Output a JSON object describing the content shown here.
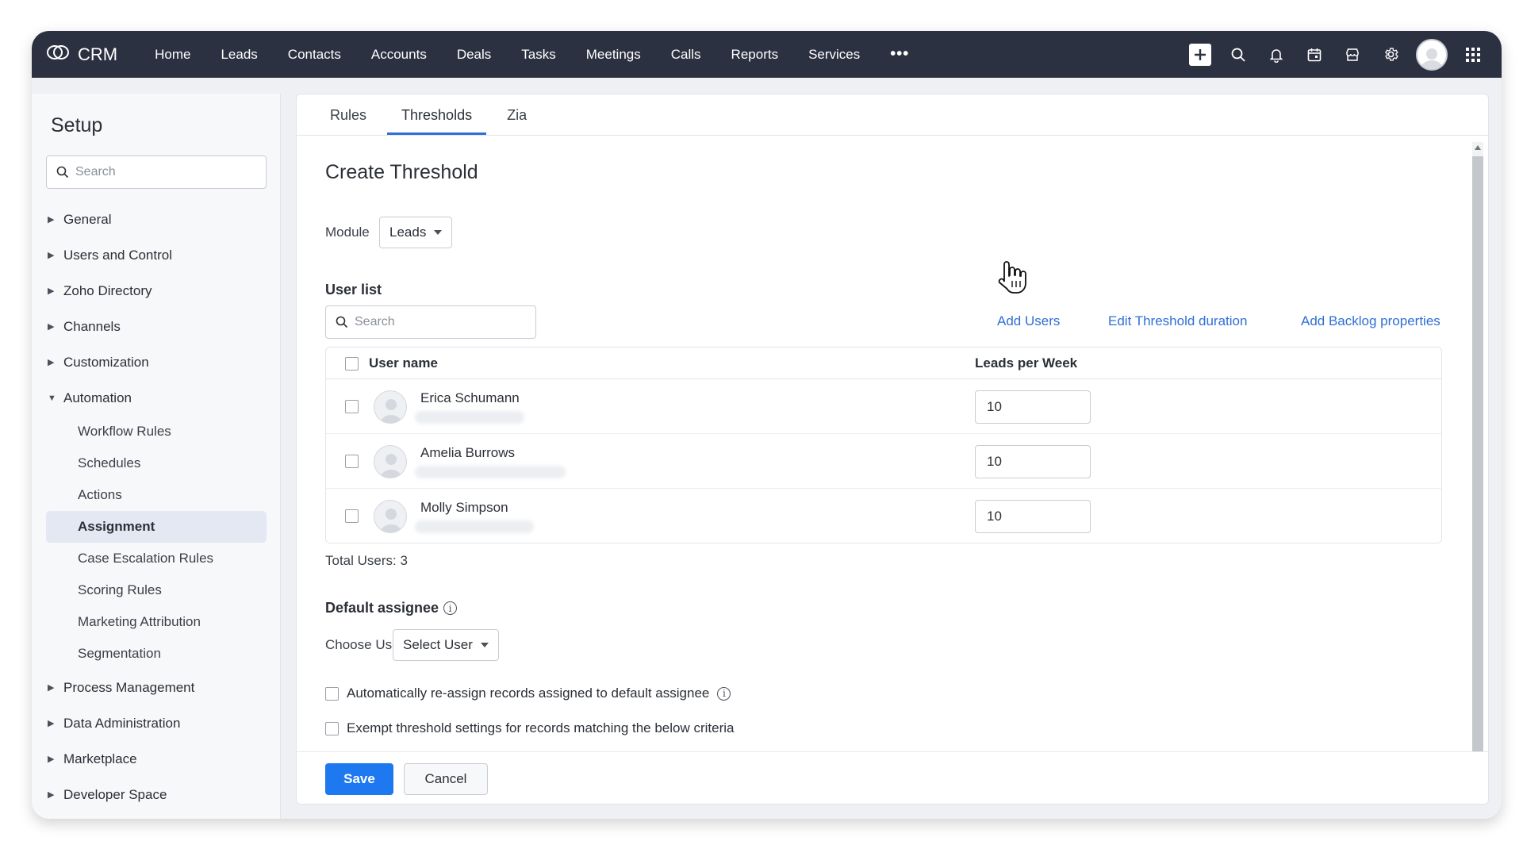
{
  "topbar": {
    "brand": "CRM",
    "nav": [
      "Home",
      "Leads",
      "Contacts",
      "Accounts",
      "Deals",
      "Tasks",
      "Meetings",
      "Calls",
      "Reports",
      "Services"
    ],
    "more": "•••",
    "icons": [
      "plus-icon",
      "search-icon",
      "bell-icon",
      "calendar-icon",
      "marketplace-icon",
      "gear-icon",
      "avatar",
      "apps-grid-icon"
    ]
  },
  "sidebar": {
    "title": "Setup",
    "search_placeholder": "Search",
    "groups": [
      {
        "label": "General"
      },
      {
        "label": "Users and Control"
      },
      {
        "label": "Zoho Directory"
      },
      {
        "label": "Channels"
      },
      {
        "label": "Customization"
      },
      {
        "label": "Automation",
        "expanded": true,
        "items": [
          "Workflow Rules",
          "Schedules",
          "Actions",
          "Assignment",
          "Case Escalation Rules",
          "Scoring Rules",
          "Marketing Attribution",
          "Segmentation"
        ],
        "active_item": "Assignment"
      },
      {
        "label": "Process Management"
      },
      {
        "label": "Data Administration"
      },
      {
        "label": "Marketplace"
      },
      {
        "label": "Developer Space"
      }
    ]
  },
  "tabs": [
    {
      "label": "Rules"
    },
    {
      "label": "Thresholds",
      "active": true
    },
    {
      "label": "Zia"
    }
  ],
  "form": {
    "title": "Create Threshold",
    "module_label": "Module",
    "module_value": "Leads",
    "user_list_label": "User list",
    "user_search_placeholder": "Search",
    "links": {
      "add_users": "Add Users",
      "edit_duration": "Edit Threshold duration",
      "add_backlog": "Add Backlog properties"
    },
    "table": {
      "col_user": "User name",
      "col_value": "Leads per Week",
      "rows": [
        {
          "name": "Erica Schumann",
          "value": "10"
        },
        {
          "name": "Amelia Burrows",
          "value": "10"
        },
        {
          "name": "Molly Simpson",
          "value": "10"
        }
      ]
    },
    "total_users": "Total Users: 3",
    "default_assignee_label": "Default assignee",
    "choose_user_label": "Choose User",
    "choose_user_value": "Select User",
    "option_reassign": "Automatically re-assign records assigned to default assignee",
    "option_exempt": "Exempt threshold settings for records matching the below criteria"
  },
  "footer": {
    "save": "Save",
    "cancel": "Cancel"
  },
  "colors": {
    "topbar": "#2c3141",
    "accent": "#2f6fd6",
    "save_button": "#1e78f0"
  }
}
